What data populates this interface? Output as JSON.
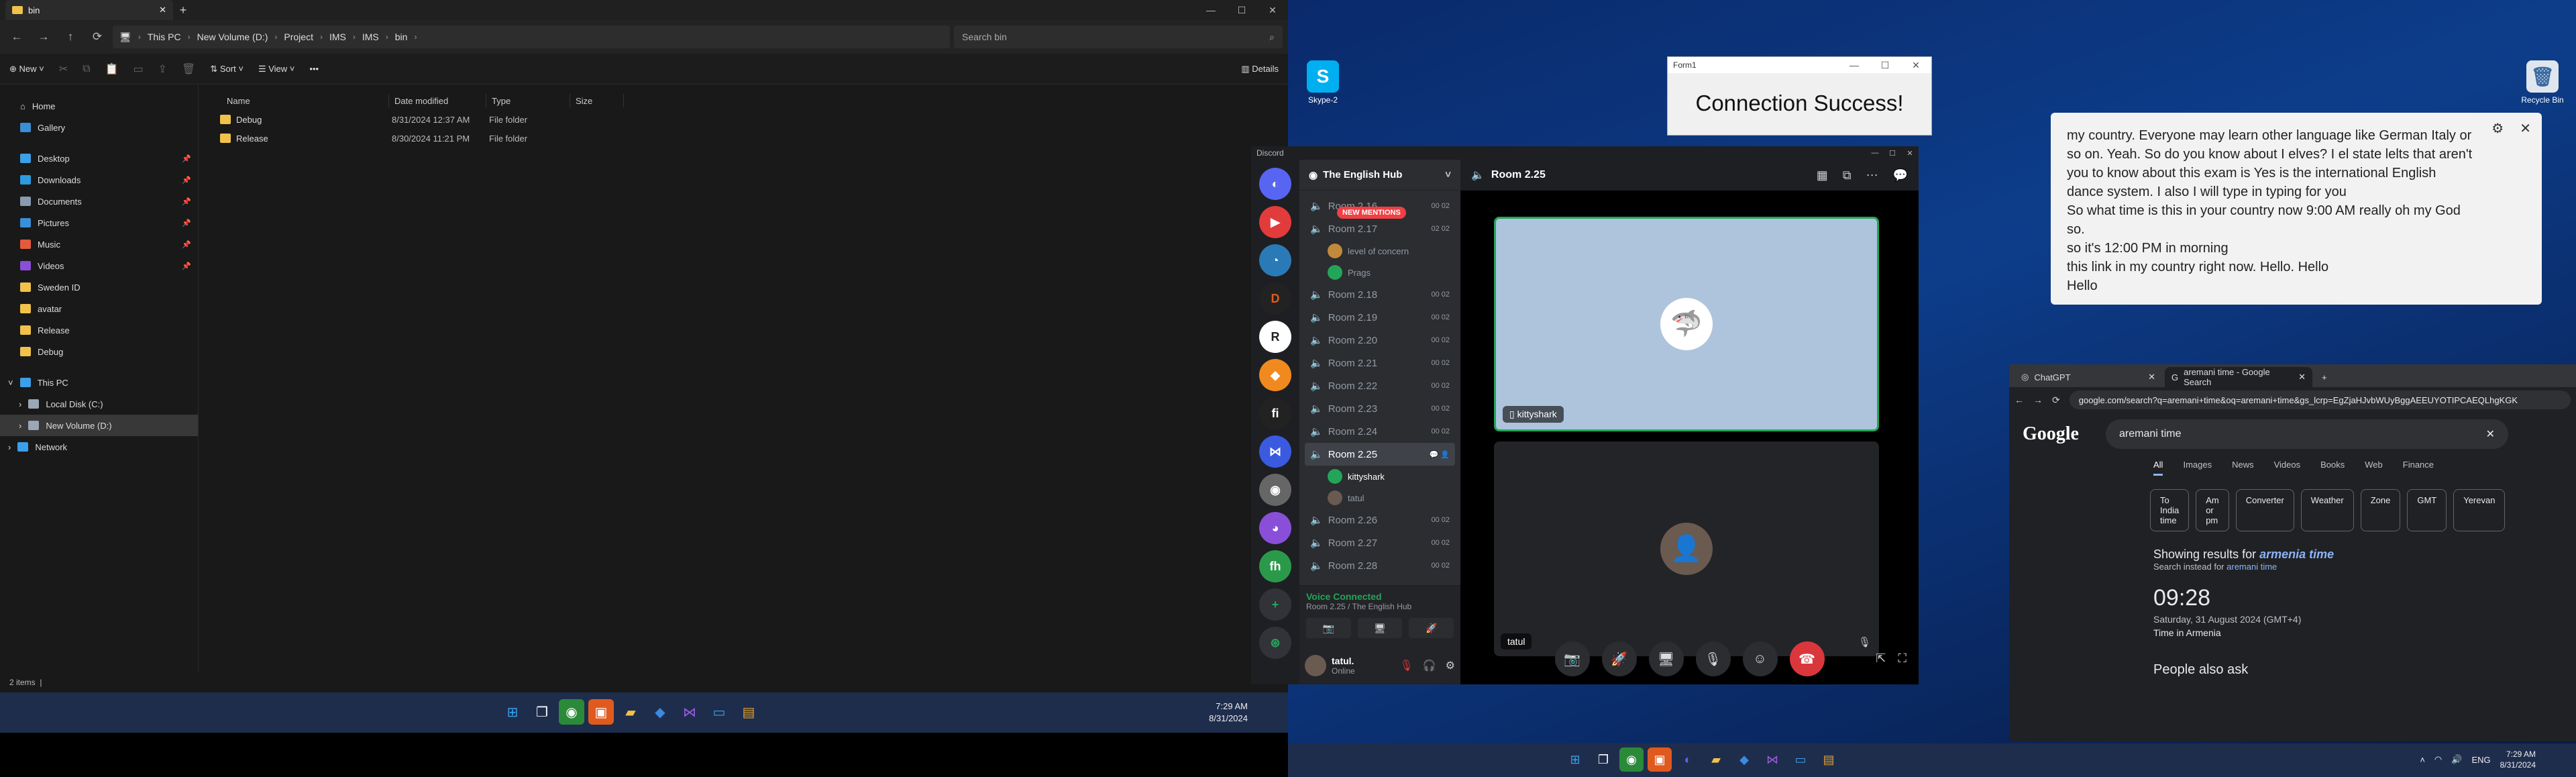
{
  "explorer": {
    "tab_title": "bin",
    "breadcrumbs": [
      "This PC",
      "New Volume (D:)",
      "Project",
      "IMS",
      "IMS",
      "bin"
    ],
    "search_placeholder": "Search bin",
    "cmd": {
      "new": "New",
      "sort": "Sort",
      "view": "View",
      "more": "•••",
      "details": "Details"
    },
    "nav": {
      "home": "Home",
      "gallery": "Gallery",
      "pinned": [
        "Desktop",
        "Downloads",
        "Documents",
        "Pictures",
        "Music",
        "Videos"
      ],
      "folders": [
        "Sweden ID",
        "avatar",
        "Release",
        "Debug"
      ],
      "this_pc": "This PC",
      "local_disk": "Local Disk (C:)",
      "new_volume": "New Volume (D:)",
      "network": "Network"
    },
    "columns": {
      "name": "Name",
      "date": "Date modified",
      "type": "Type",
      "size": "Size"
    },
    "files": [
      {
        "name": "Debug",
        "date": "8/31/2024 12:37 AM",
        "type": "File folder"
      },
      {
        "name": "Release",
        "date": "8/30/2024 11:21 PM",
        "type": "File folder"
      }
    ],
    "status": "2 items"
  },
  "taskbar_left": {
    "time": "7:29 AM",
    "date": "8/31/2024"
  },
  "desktop": {
    "skype_label": "Skype-2",
    "recycle_label": "Recycle Bin"
  },
  "form1": {
    "title": "Form1",
    "message": "Connection Success!"
  },
  "captions": {
    "lines": [
      "my country. Everyone may learn other language like German Italy or",
      "so on. Yeah. So do you know about I elves? I el state lelts that aren't",
      "you to know about this exam is Yes is the international English",
      "dance system. I also I will type in typing for you",
      "So what time is this in your country now 9:00 AM really oh my God",
      "so.",
      "so it's 12:00 PM in morning",
      "this link in my country right now. Hello. Hello",
      "Hello"
    ]
  },
  "discord": {
    "app_title": "Discord",
    "server_name": "The English Hub",
    "new_mentions": "NEW MENTIONS",
    "channels": [
      {
        "name": "Room 2.16",
        "count": "00 02"
      },
      {
        "name": "Room 2.17",
        "count": "02 02"
      },
      {
        "name": "Room 2.18",
        "count": "00 02"
      },
      {
        "name": "Room 2.19",
        "count": "00 02"
      },
      {
        "name": "Room 2.20",
        "count": "00 02"
      },
      {
        "name": "Room 2.21",
        "count": "00 02"
      },
      {
        "name": "Room 2.22",
        "count": "00 02"
      },
      {
        "name": "Room 2.23",
        "count": "00 02"
      },
      {
        "name": "Room 2.24",
        "count": "00 02"
      },
      {
        "name": "Room 2.25",
        "count": ""
      },
      {
        "name": "Room 2.26",
        "count": "00 02"
      },
      {
        "name": "Room 2.27",
        "count": "00 02"
      },
      {
        "name": "Room 2.28",
        "count": "00 02"
      }
    ],
    "room217_users": [
      "level of concern",
      "Prags"
    ],
    "room225_users": [
      "kittyshark",
      "tatul"
    ],
    "voice_status": "Voice Connected",
    "voice_sub": "Room 2.25 / The English Hub",
    "user_name": "tatul.",
    "user_status": "Online",
    "room_title": "Room 2.25",
    "tile1_name": "kittyshark",
    "tile2_name": "tatul"
  },
  "chrome": {
    "tabs": [
      "ChatGPT",
      "aremani time - Google Search"
    ],
    "url": "google.com/search?q=aremani+time&oq=aremani+time&gs_lcrp=EgZjaHJvbWUyBggAEEUYOTIPCAEQLhgKGK",
    "query": "aremani time",
    "filters": [
      "All",
      "Images",
      "News",
      "Videos",
      "Books",
      "Web",
      "Finance"
    ],
    "chips": [
      "To India time",
      "Am or pm",
      "Converter",
      "Weather",
      "Zone",
      "GMT",
      "Yerevan"
    ],
    "showing_prefix": "Showing results for",
    "showing_term": "armenia time",
    "instead_prefix": "Search instead for",
    "instead_term": "aremani time",
    "time": "09:28",
    "date": "Saturday, 31 August 2024 (GMT+4)",
    "where": "Time in Armenia",
    "paa": "People also ask"
  },
  "taskbar_right": {
    "lang": "ENG",
    "time": "7:29 AM",
    "date": "8/31/2024"
  }
}
